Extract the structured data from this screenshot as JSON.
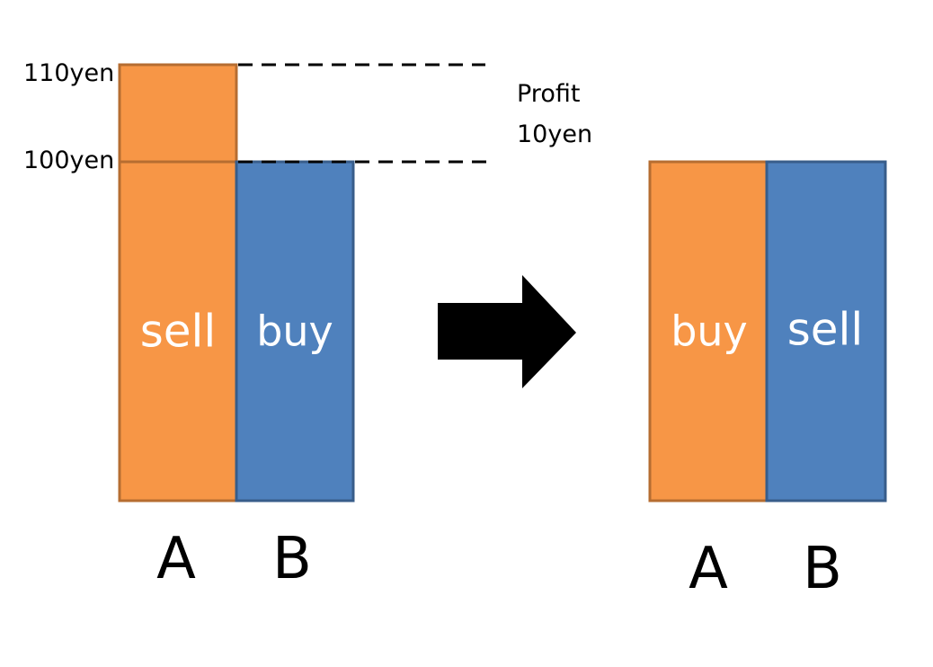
{
  "colors": {
    "orange": "#F79646",
    "orange_border": "#B66D31",
    "blue": "#4F81BD",
    "blue_border": "#385D8A",
    "text_on_bar": "#FFFFFF",
    "text": "#000000",
    "arrow": "#000000"
  },
  "left": {
    "price_high": "110yen",
    "price_low": "100yen",
    "profit_line1": "Profit",
    "profit_line2": "10yen",
    "bar_a_label": "sell",
    "bar_b_label": "buy",
    "axis_a": "A",
    "axis_b": "B"
  },
  "arrow": {
    "icon": "right-arrow-icon"
  },
  "right": {
    "bar_a_label": "buy",
    "bar_b_label": "sell",
    "axis_a": "A",
    "axis_b": "B"
  }
}
